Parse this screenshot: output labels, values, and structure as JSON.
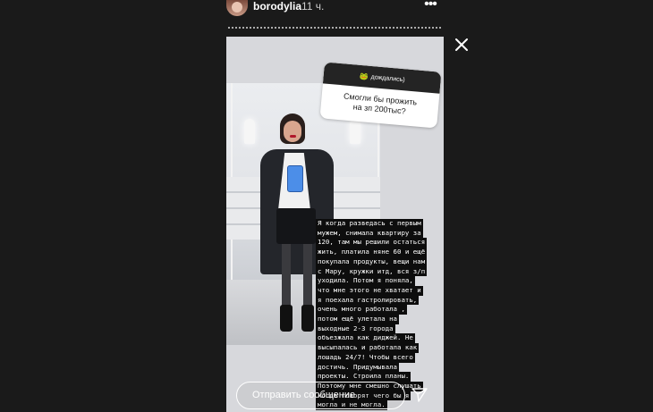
{
  "header": {
    "username": "borodylia",
    "time": "11 ч.",
    "more_icon": "more-dots-icon"
  },
  "poll": {
    "header_text": "дождались)",
    "emoji": "🐸",
    "question": "Смогли бы прожить на зп 200тыс?"
  },
  "caption": {
    "lines": [
      "Я когда разведась с первым",
      "мужем, снимала квартиру за",
      "120, там мы решили остаться",
      "жить, платила няне 60 и ещё",
      "покупала продукты, вещи нам",
      "с Мару, кружки итд, вся з/п",
      "уходила. Потом я поняла,",
      "что мне этого не хватает и",
      "я поехала гастролировать,",
      "очень много работала ,",
      "потом ещё улетала на",
      "выходные 2-3 города",
      "объезжала как диджей. Не",
      "высыпалась и работала как",
      "лошадь 24/7! Чтобы всего",
      "достичь. Придумывала",
      "проекты. Строила планы.",
      "Поэтому мне смешно слушать",
      "когда говорят чего бы я",
      "могла и не могла."
    ]
  },
  "reply": {
    "placeholder": "Отправить сообщение"
  },
  "icons": {
    "close": "close-icon",
    "send": "send-icon"
  },
  "colors": {
    "background": "#1a1a1a",
    "text_highlight": "#0d0d0d",
    "sticker_header": "#242424"
  }
}
